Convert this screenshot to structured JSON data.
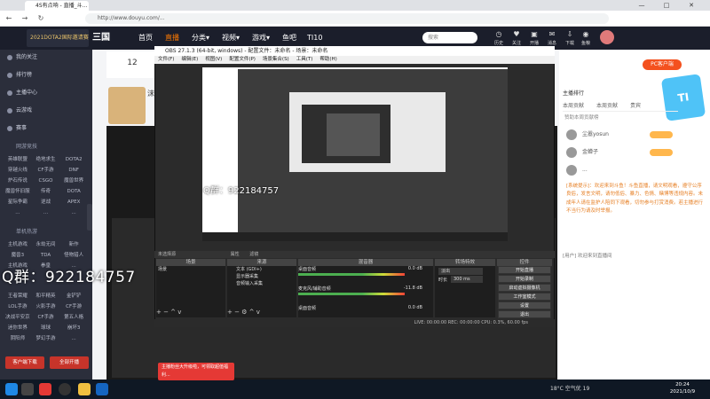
{
  "browser": {
    "tab_title": "4S有点响 - 直播_斗鱼...",
    "url": "http://www.douyu.com/...",
    "back": "←",
    "forward": "→",
    "reload": "↻",
    "minimize": "—",
    "maximize": "□",
    "close": "✕"
  },
  "site": {
    "logo_text": "2021DOTA2国际邀请赛",
    "brand": "三国",
    "nav": [
      "首页",
      "直播",
      "分类▾",
      "视频▾",
      "游戏▾",
      "鱼吧",
      "TI10"
    ],
    "search_placeholder": "搜索",
    "top_icons": [
      {
        "icon": "history-icon",
        "label": "历史"
      },
      {
        "icon": "follow-icon",
        "label": "关注"
      },
      {
        "icon": "broadcast-icon",
        "label": "开播"
      },
      {
        "icon": "message-icon",
        "label": "消息"
      },
      {
        "icon": "download-icon",
        "label": "下载"
      },
      {
        "icon": "fish-icon",
        "label": "鱼粮"
      }
    ]
  },
  "sidebar": {
    "items": [
      "我的关注",
      "排行榜",
      "主播中心",
      "云游戏",
      "赛事"
    ],
    "section1": "网游竞技",
    "grid1": [
      [
        "英雄联盟",
        "绝地求生",
        "DOTA2"
      ],
      [
        "穿越火线",
        "CF手游",
        "DNF"
      ],
      [
        "炉石传说",
        "CSGO",
        "魔兽世界"
      ],
      [
        "魔兽怀旧服",
        "传奇",
        "DOTA"
      ],
      [
        "星际争霸",
        "逆战",
        "APEX"
      ],
      [
        "...",
        "...",
        "..."
      ]
    ],
    "section2": "单机热游",
    "grid2": [
      [
        "主机游戏",
        "永劫无间",
        "新作"
      ],
      [
        "魔兽3",
        "TDA",
        "怪物猎人"
      ],
      [
        "主机游戏",
        "拳皇",
        "..."
      ]
    ],
    "grid3": [
      [
        "王者荣耀",
        "和平精英",
        "金铲铲"
      ],
      [
        "LOL手游",
        "火影手游",
        "CF手游"
      ],
      [
        "决战平安京",
        "CF手游",
        "第五人格"
      ],
      [
        "迷你世界",
        "球球",
        "崩坏3"
      ],
      [
        "阴阳师",
        "梦幻手游",
        "..."
      ]
    ],
    "buttons": [
      "客户端下载",
      "全部开播"
    ]
  },
  "room": {
    "level": "12",
    "streamer_tag": "沫宇"
  },
  "watermark": "Q群：922184757",
  "obs": {
    "title": "OBS 27.1.3 (64-bit, windows) - 配置文件：未命名 - 场景：未命名",
    "menu": [
      "文件(F)",
      "编辑(E)",
      "视图(V)",
      "配置文件(P)",
      "场景集合(S)",
      "工具(T)",
      "帮助(H)"
    ],
    "preview_watermark": "Q群：922184757",
    "dock_label": "未选择源",
    "dock_buttons": [
      "属性",
      "滤镜"
    ],
    "panels": [
      "场景",
      "来源",
      "混音器",
      "转场特效",
      "控件"
    ],
    "scene_item": "场景",
    "sources": [
      "文本 (GDI+)",
      "显示器采集",
      "音频输入采集"
    ],
    "mixer": [
      {
        "name": "桌面音频",
        "db": "0.0 dB"
      },
      {
        "name": "麦克风/辅助音频",
        "db": "-11.8 dB"
      },
      {
        "name": "桌面音频",
        "db": "0.0 dB"
      }
    ],
    "transition": "淡出",
    "duration_label": "时长",
    "duration_value": "300 ms",
    "controls": [
      "开始直播",
      "开始录制",
      "启动虚拟摄像机",
      "工作室模式",
      "设置",
      "退出"
    ],
    "status": "LIVE: 00:00:00  REC: 00:00:00  CPU: 0.3%, 60.00 fps"
  },
  "ad_text": "主播粉丝大升级啦，可领取超值福利...",
  "right": {
    "pc_button": "PC客户端",
    "rank_title": "主播排行",
    "rank_tabs": [
      "本周贡献",
      "本周贡献",
      "贵宾"
    ],
    "rank_notice": "赞助本周贡献榜",
    "rank_rows": [
      "尘嚣yosun",
      "金蝉子",
      "...",
      "..."
    ],
    "chat": "[系统提示]：欢迎来到斗鱼！斗鱼直播，请文明观看，遵守公序良俗，发言文明，请勿低俗、暴力、色情、赌博等违规内容。未成年人请在监护人陪同下观看，切勿参与打赏消费。若主播进行不当行为请及时举报。",
    "chatline": "[用户] 欢迎来到直播间",
    "mascot": "TI"
  },
  "taskbar": {
    "weather": "18°C 空气优 19",
    "time": "20:24",
    "date": "2021/10/9"
  }
}
